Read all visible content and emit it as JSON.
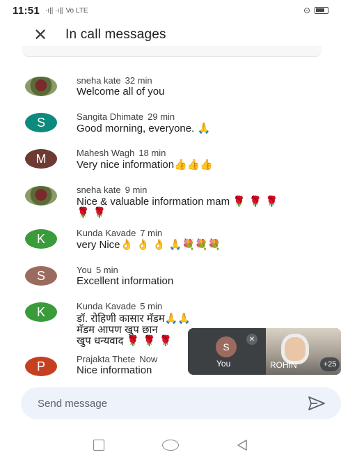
{
  "status_bar": {
    "time": "11:51",
    "network_label": "Vo LTE",
    "signal_text": "·ı|| ·ı||",
    "alarm_glyph": "⊙"
  },
  "header": {
    "title": "In call messages",
    "close_glyph": "✕"
  },
  "messages": [
    {
      "sender": "sneha kate",
      "time": "32 min",
      "text": "Welcome all of you",
      "avatar_letter": "",
      "avatar_type": "photo",
      "avatar_color": ""
    },
    {
      "sender": "Sangita Dhimate",
      "time": "29 min",
      "text": "Good morning, everyone. ",
      "emoji": "🙏",
      "avatar_letter": "S",
      "avatar_type": "letter",
      "avatar_color": "#0b8a7d"
    },
    {
      "sender": "Mahesh Wagh",
      "time": "18 min",
      "text": "Very nice information",
      "emoji": "👍👍👍",
      "avatar_letter": "M",
      "avatar_type": "letter",
      "avatar_color": "#6d3b33"
    },
    {
      "sender": "sneha kate",
      "time": "9 min",
      "text": "Nice & valuable information mam ",
      "emoji": "🌹 🌹 🌹",
      "emoji_line2": "🌹 🌹",
      "avatar_letter": "",
      "avatar_type": "photo",
      "avatar_color": ""
    },
    {
      "sender": "Kunda Kavade",
      "time": "7 min",
      "text": "very Nice",
      "emoji": "👌 👌 👌 🙏💐💐💐",
      "avatar_letter": "K",
      "avatar_type": "letter",
      "avatar_color": "#3a9b3a"
    },
    {
      "sender": "You",
      "time": "5 min",
      "text": "Excellent information",
      "avatar_letter": "S",
      "avatar_type": "letter",
      "avatar_color": "#9c6b5f"
    },
    {
      "sender": "Kunda Kavade",
      "time": "5 min",
      "text": "डॉ. रोहिणी कासार मॅडम",
      "emoji": "🙏🙏",
      "text_line2": "मॅडम आपण खुप छान",
      "text_line3": "खुप धन्यवाद ",
      "emoji_line3": "🌹 🌹 🌹",
      "avatar_letter": "K",
      "avatar_type": "letter",
      "avatar_color": "#3a9b3a"
    },
    {
      "sender": "Prajakta Thete",
      "time": "Now",
      "text": "Nice information",
      "avatar_letter": "P",
      "avatar_type": "letter",
      "avatar_color": "#c5401f"
    }
  ],
  "pip": {
    "you_letter": "S",
    "you_label": "You",
    "participant_name": "ROHIN",
    "more_count": "+25"
  },
  "composer": {
    "placeholder": "Send message"
  },
  "colors": {
    "accent": "#1a73e8",
    "composer_bg": "#eef3fb"
  }
}
